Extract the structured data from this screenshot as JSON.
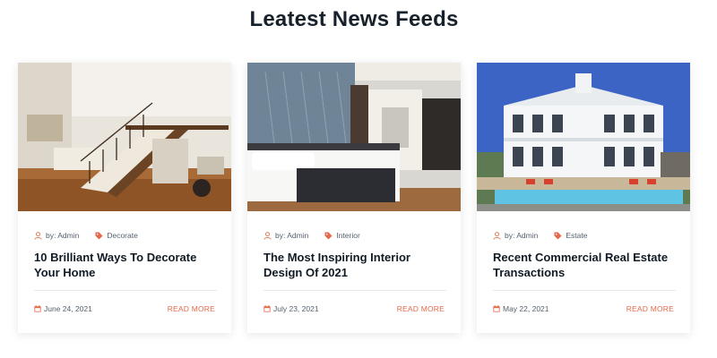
{
  "section": {
    "title": "Leatest News Feeds"
  },
  "colors": {
    "accent": "#e36a4a",
    "title": "#17212b",
    "meta": "#566270"
  },
  "icons": {
    "author": "user-icon",
    "category": "tag-icon",
    "date": "calendar-icon"
  },
  "posts": [
    {
      "image": "staircase-living-room-photo",
      "author": "by: Admin",
      "category": "Decorate",
      "title": "10 Brilliant Ways To Decorate Your Home",
      "date": "June 24, 2021",
      "read_more": "READ MORE"
    },
    {
      "image": "hotel-bedroom-photo",
      "author": "by: Admin",
      "category": "Interior",
      "title": "The Most Inspiring Interior Design Of 2021",
      "date": "July 23, 2021",
      "read_more": "READ MORE"
    },
    {
      "image": "white-mansion-with-pool-photo",
      "author": "by: Admin",
      "category": "Estate",
      "title": "Recent Commercial Real Estate Transactions",
      "date": "May 22, 2021",
      "read_more": "READ MORE"
    }
  ]
}
